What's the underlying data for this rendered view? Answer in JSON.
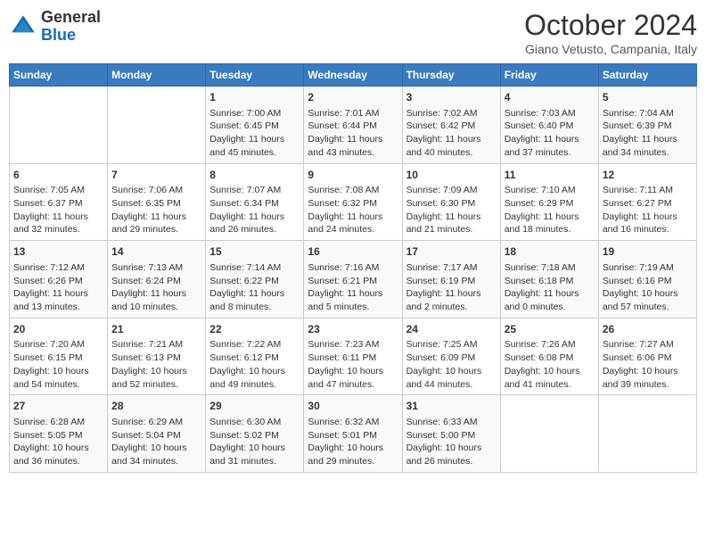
{
  "header": {
    "logo_general": "General",
    "logo_blue": "Blue",
    "month": "October 2024",
    "location": "Giano Vetusto, Campania, Italy"
  },
  "days_of_week": [
    "Sunday",
    "Monday",
    "Tuesday",
    "Wednesday",
    "Thursday",
    "Friday",
    "Saturday"
  ],
  "weeks": [
    [
      {
        "day": "",
        "data": ""
      },
      {
        "day": "",
        "data": ""
      },
      {
        "day": "1",
        "data": "Sunrise: 7:00 AM\nSunset: 6:45 PM\nDaylight: 11 hours and 45 minutes."
      },
      {
        "day": "2",
        "data": "Sunrise: 7:01 AM\nSunset: 6:44 PM\nDaylight: 11 hours and 43 minutes."
      },
      {
        "day": "3",
        "data": "Sunrise: 7:02 AM\nSunset: 6:42 PM\nDaylight: 11 hours and 40 minutes."
      },
      {
        "day": "4",
        "data": "Sunrise: 7:03 AM\nSunset: 6:40 PM\nDaylight: 11 hours and 37 minutes."
      },
      {
        "day": "5",
        "data": "Sunrise: 7:04 AM\nSunset: 6:39 PM\nDaylight: 11 hours and 34 minutes."
      }
    ],
    [
      {
        "day": "6",
        "data": "Sunrise: 7:05 AM\nSunset: 6:37 PM\nDaylight: 11 hours and 32 minutes."
      },
      {
        "day": "7",
        "data": "Sunrise: 7:06 AM\nSunset: 6:35 PM\nDaylight: 11 hours and 29 minutes."
      },
      {
        "day": "8",
        "data": "Sunrise: 7:07 AM\nSunset: 6:34 PM\nDaylight: 11 hours and 26 minutes."
      },
      {
        "day": "9",
        "data": "Sunrise: 7:08 AM\nSunset: 6:32 PM\nDaylight: 11 hours and 24 minutes."
      },
      {
        "day": "10",
        "data": "Sunrise: 7:09 AM\nSunset: 6:30 PM\nDaylight: 11 hours and 21 minutes."
      },
      {
        "day": "11",
        "data": "Sunrise: 7:10 AM\nSunset: 6:29 PM\nDaylight: 11 hours and 18 minutes."
      },
      {
        "day": "12",
        "data": "Sunrise: 7:11 AM\nSunset: 6:27 PM\nDaylight: 11 hours and 16 minutes."
      }
    ],
    [
      {
        "day": "13",
        "data": "Sunrise: 7:12 AM\nSunset: 6:26 PM\nDaylight: 11 hours and 13 minutes."
      },
      {
        "day": "14",
        "data": "Sunrise: 7:13 AM\nSunset: 6:24 PM\nDaylight: 11 hours and 10 minutes."
      },
      {
        "day": "15",
        "data": "Sunrise: 7:14 AM\nSunset: 6:22 PM\nDaylight: 11 hours and 8 minutes."
      },
      {
        "day": "16",
        "data": "Sunrise: 7:16 AM\nSunset: 6:21 PM\nDaylight: 11 hours and 5 minutes."
      },
      {
        "day": "17",
        "data": "Sunrise: 7:17 AM\nSunset: 6:19 PM\nDaylight: 11 hours and 2 minutes."
      },
      {
        "day": "18",
        "data": "Sunrise: 7:18 AM\nSunset: 6:18 PM\nDaylight: 11 hours and 0 minutes."
      },
      {
        "day": "19",
        "data": "Sunrise: 7:19 AM\nSunset: 6:16 PM\nDaylight: 10 hours and 57 minutes."
      }
    ],
    [
      {
        "day": "20",
        "data": "Sunrise: 7:20 AM\nSunset: 6:15 PM\nDaylight: 10 hours and 54 minutes."
      },
      {
        "day": "21",
        "data": "Sunrise: 7:21 AM\nSunset: 6:13 PM\nDaylight: 10 hours and 52 minutes."
      },
      {
        "day": "22",
        "data": "Sunrise: 7:22 AM\nSunset: 6:12 PM\nDaylight: 10 hours and 49 minutes."
      },
      {
        "day": "23",
        "data": "Sunrise: 7:23 AM\nSunset: 6:11 PM\nDaylight: 10 hours and 47 minutes."
      },
      {
        "day": "24",
        "data": "Sunrise: 7:25 AM\nSunset: 6:09 PM\nDaylight: 10 hours and 44 minutes."
      },
      {
        "day": "25",
        "data": "Sunrise: 7:26 AM\nSunset: 6:08 PM\nDaylight: 10 hours and 41 minutes."
      },
      {
        "day": "26",
        "data": "Sunrise: 7:27 AM\nSunset: 6:06 PM\nDaylight: 10 hours and 39 minutes."
      }
    ],
    [
      {
        "day": "27",
        "data": "Sunrise: 6:28 AM\nSunset: 5:05 PM\nDaylight: 10 hours and 36 minutes."
      },
      {
        "day": "28",
        "data": "Sunrise: 6:29 AM\nSunset: 5:04 PM\nDaylight: 10 hours and 34 minutes."
      },
      {
        "day": "29",
        "data": "Sunrise: 6:30 AM\nSunset: 5:02 PM\nDaylight: 10 hours and 31 minutes."
      },
      {
        "day": "30",
        "data": "Sunrise: 6:32 AM\nSunset: 5:01 PM\nDaylight: 10 hours and 29 minutes."
      },
      {
        "day": "31",
        "data": "Sunrise: 6:33 AM\nSunset: 5:00 PM\nDaylight: 10 hours and 26 minutes."
      },
      {
        "day": "",
        "data": ""
      },
      {
        "day": "",
        "data": ""
      }
    ]
  ]
}
